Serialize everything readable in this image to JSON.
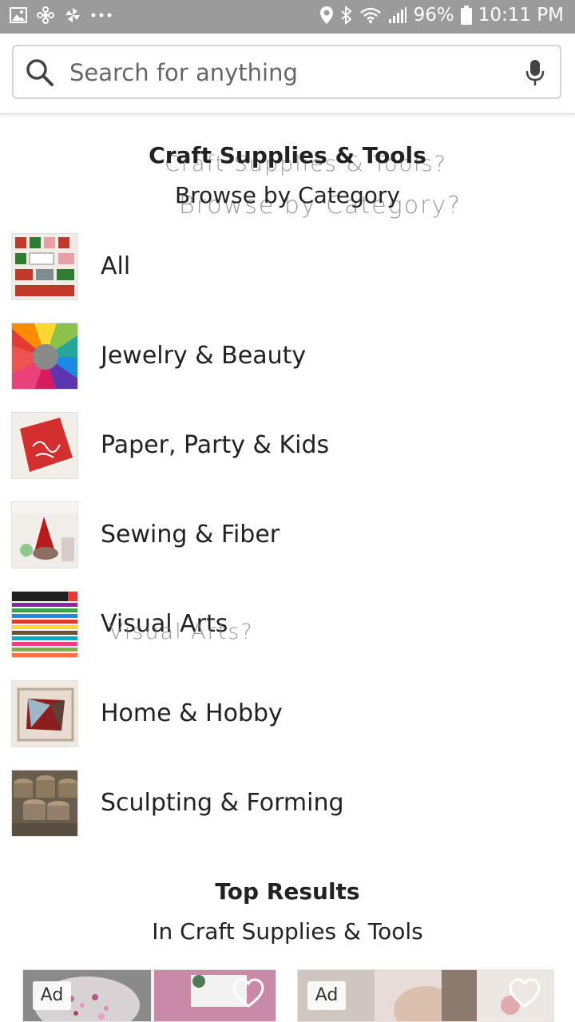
{
  "status_bar": {
    "battery": "96%",
    "time": "10:11 PM",
    "icons": [
      "gallery-icon",
      "pinwheel-icon",
      "fan-icon",
      "more-dots-icon",
      "location-icon",
      "bluetooth-icon",
      "wifi-icon",
      "signal-icon",
      "battery-icon"
    ]
  },
  "search": {
    "placeholder": "Search for anything"
  },
  "header": {
    "title": "Craft Supplies & Tools",
    "subtitle": "Browse by Category",
    "ghost_title": "Craft Supplies & Tools?",
    "ghost_subtitle": "Browse by Category?"
  },
  "categories": [
    {
      "label": "All"
    },
    {
      "label": "Jewelry & Beauty"
    },
    {
      "label": "Paper, Party & Kids"
    },
    {
      "label": "Sewing & Fiber"
    },
    {
      "label": "Visual Arts",
      "ghost": "Visual Arts?"
    },
    {
      "label": "Home & Hobby"
    },
    {
      "label": "Sculpting & Forming"
    }
  ],
  "top_results": {
    "title": "Top Results",
    "subtitle": "In Craft Supplies & Tools"
  },
  "cards": [
    {
      "badge": "Ad"
    },
    {
      "badge": "Ad"
    }
  ],
  "colors": {
    "status_bar": "#9b9b9b",
    "text": "#222222",
    "border": "#d4d4d4"
  }
}
